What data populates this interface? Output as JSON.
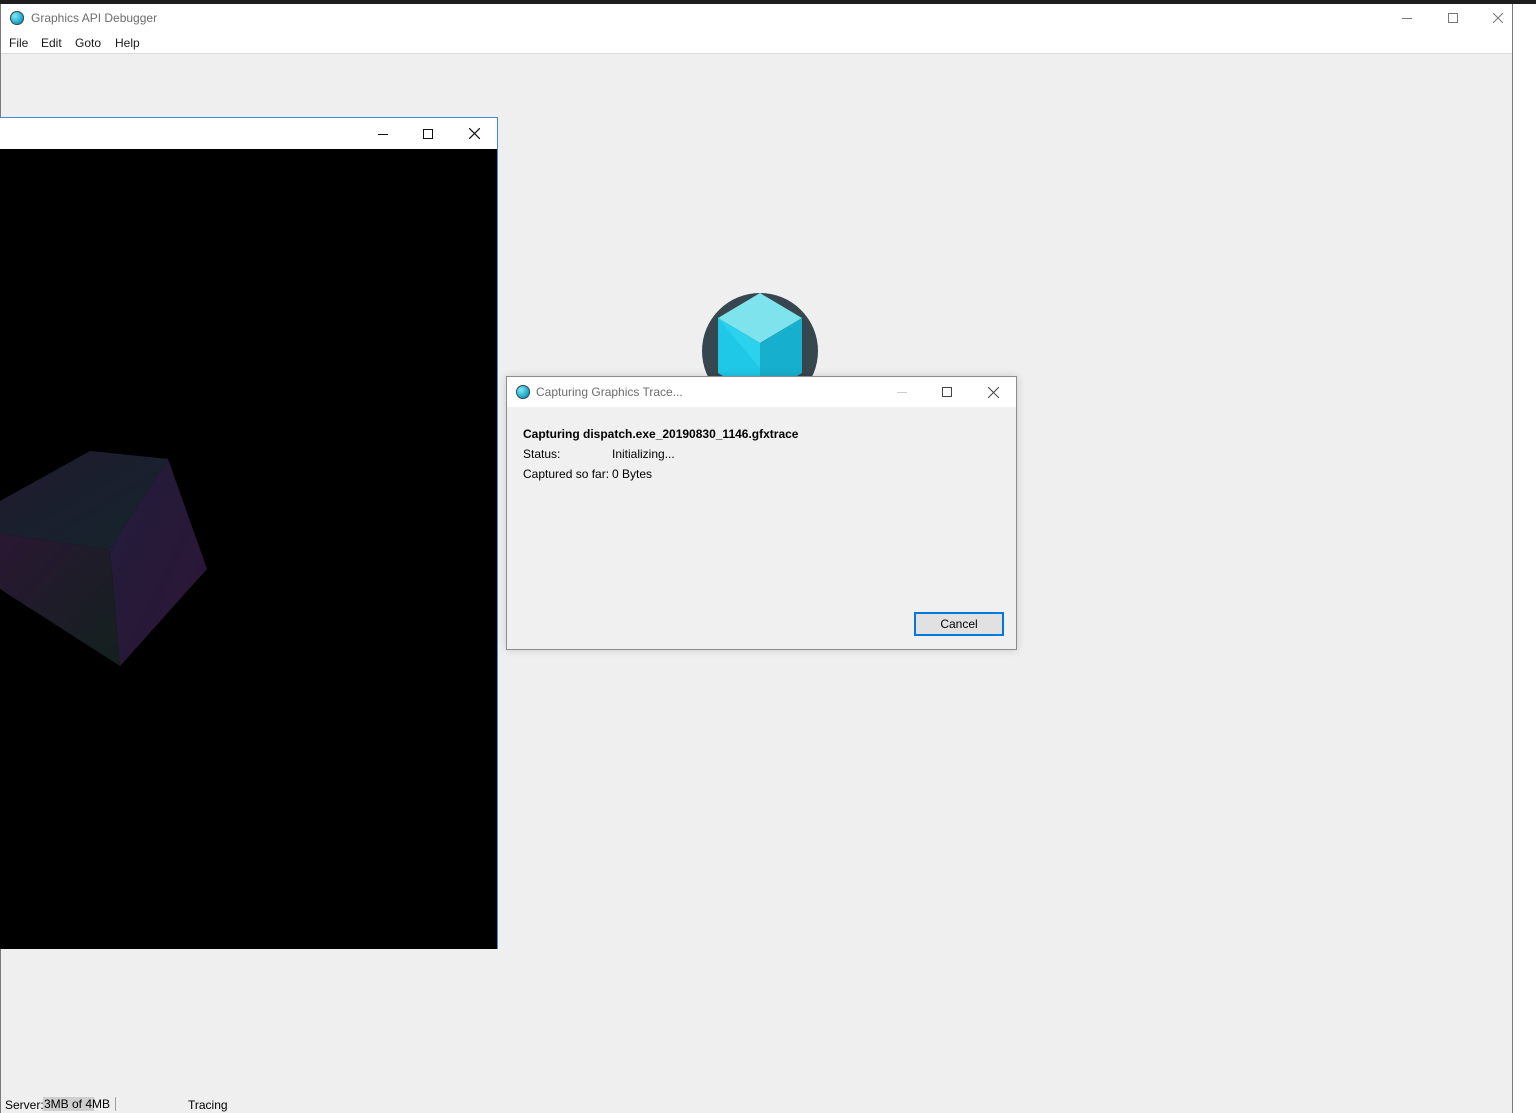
{
  "main_window": {
    "title": "Graphics API Debugger",
    "icon": "app-icon",
    "menu": [
      "File",
      "Edit",
      "Goto",
      "Help"
    ],
    "caption_buttons": [
      "minimize-icon",
      "maximize-icon",
      "close-icon"
    ]
  },
  "logo": {
    "icon": "cube-logo-icon"
  },
  "render_window": {
    "title": "",
    "caption_buttons": [
      "minimize-icon",
      "maximize-icon",
      "close-icon"
    ]
  },
  "dialog": {
    "title": "Capturing Graphics Trace...",
    "heading": "Capturing dispatch.exe_20190830_1146.gfxtrace",
    "status_label": "Status:",
    "status_value": "Initializing...",
    "captured_label": "Captured so far:",
    "captured_value": "0 Bytes",
    "cancel_label": "Cancel"
  },
  "statusbar": {
    "server_label": "Server:",
    "server_value": "3MB of 4MB",
    "server_fraction": 0.75,
    "tracing_label": "Tracing"
  },
  "colors": {
    "accent": "#0078d7",
    "logo_bg": "#37474f",
    "logo_cube": "#29d6f0"
  }
}
